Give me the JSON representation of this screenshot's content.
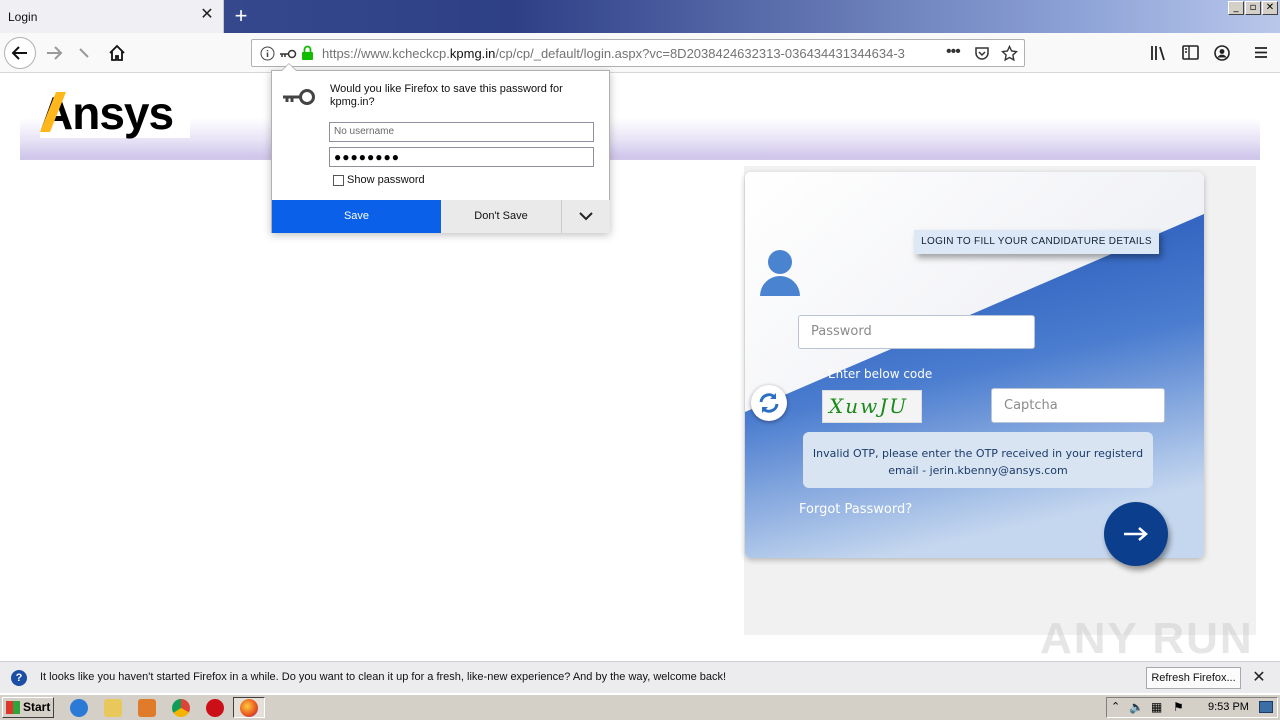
{
  "browser": {
    "tab_title": "Login",
    "tab_close": "✕",
    "new_tab": "+",
    "url_prefix": "https://www.kcheckcp.",
    "url_domain": "kpmg.in",
    "url_rest": "/cp/cp/_default/login.aspx?vc=8D2038424632313-036434431344634-3",
    "window_controls": [
      "_",
      "▫",
      "✕"
    ]
  },
  "page": {
    "logo_text": "Ansys",
    "login_banner": "Login to fill your candidature details",
    "password_placeholder": "Password",
    "enter_code_label": "Enter below code",
    "captcha_code": "XuwJU",
    "captcha_placeholder": "Captcha",
    "error_line1": "Invalid OTP, please enter the OTP received in your registerd",
    "error_line2": "email - jerin.kbenny@ansys.com",
    "forgot_password": "Forgot Password?",
    "watermark": "ANY RUN"
  },
  "popup": {
    "message": "Would you like Firefox to save this password for kpmg.in?",
    "username_placeholder": "No username",
    "password_mask": "●●●●●●●●",
    "show_password": "Show password",
    "save": "Save",
    "dont_save": "Don't Save"
  },
  "notification": {
    "text": "It looks like you haven't started Firefox in a while. Do you want to clean it up for a fresh, like-new experience? And by the way, welcome back!",
    "button": "Refresh Firefox...",
    "close": "✕"
  },
  "taskbar": {
    "start": "Start",
    "clock": "9:53 PM"
  },
  "colors": {
    "accent_blue": "#0b3f8e",
    "save_blue": "#0a60e8",
    "captcha_green": "#1a8a1a"
  }
}
